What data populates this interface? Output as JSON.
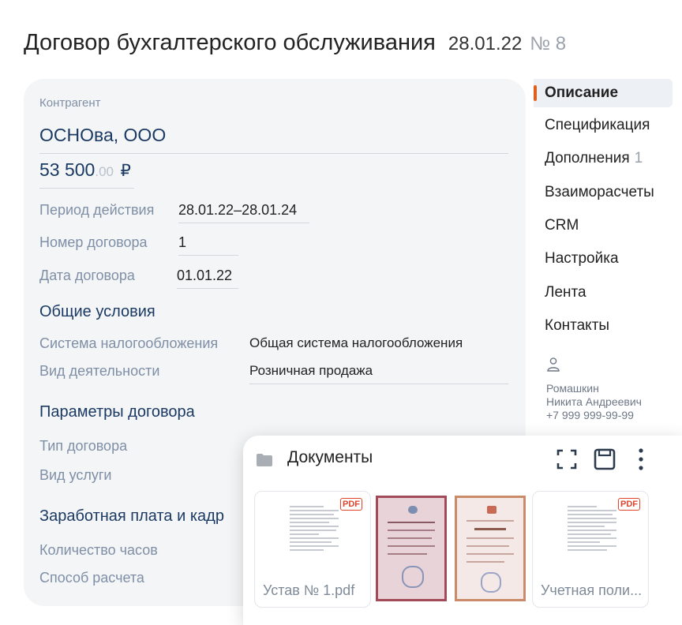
{
  "header": {
    "title": "Договор бухгалтерского обслуживания",
    "date": "28.01.22",
    "number": "№ 8"
  },
  "card": {
    "counterparty_label": "Контрагент",
    "counterparty_name": "ОСНОва, ООО",
    "amount_main": "53 500",
    "amount_cents": ".00",
    "currency": "₽",
    "period_label": "Период действия",
    "period_value": "28.01.22–28.01.24",
    "number_label": "Номер договора",
    "number_value": "1",
    "date_label": "Дата договора",
    "date_value": "01.01.22",
    "section_general": "Общие условия",
    "tax_label": "Система налогообложения",
    "tax_value": "Общая система налогообложения",
    "activity_label": "Вид деятельности",
    "activity_value": "Розничная продажа",
    "section_params": "Параметры договора",
    "type_label": "Тип договора",
    "service_label": "Вид услуги",
    "section_salary": "Заработная плата и кадр",
    "hours_label": "Количество часов",
    "calc_label": "Способ расчета"
  },
  "nav": {
    "items": [
      {
        "label": "Описание"
      },
      {
        "label": "Спецификация"
      },
      {
        "label": "Дополнения",
        "count": "1"
      },
      {
        "label": "Взаиморасчеты"
      },
      {
        "label": "CRM"
      },
      {
        "label": "Настройка"
      },
      {
        "label": "Лента"
      },
      {
        "label": "Контакты"
      }
    ],
    "active_index": 0
  },
  "person": {
    "surname": "Ромашкин",
    "name": "Никита Андреевич",
    "phone": "+7 999 999-99-99"
  },
  "documents": {
    "title": "Документы",
    "files": [
      {
        "name": "Устав № 1.pdf",
        "badge": "PDF"
      },
      {
        "name": ""
      },
      {
        "name": ""
      },
      {
        "name": "Учетная поли...",
        "badge": "PDF"
      }
    ]
  },
  "colors": {
    "accent": "#e0601b",
    "heading": "#1b3a63",
    "label": "#7f8fa6"
  }
}
